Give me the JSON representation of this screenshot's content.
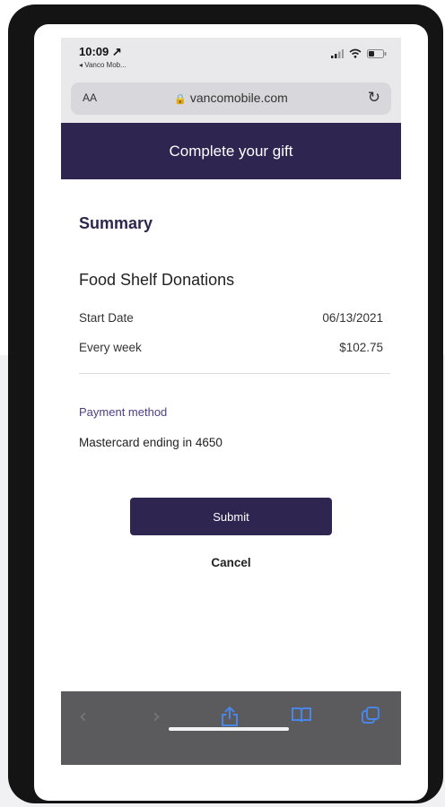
{
  "status_bar": {
    "time": "10:09 ↗",
    "back_app": "◂ Vanco Mob..."
  },
  "browser": {
    "aa_label": "AA",
    "url": "vancomobile.com",
    "lock_icon": "lock-icon",
    "reload_icon": "reload-icon"
  },
  "header": {
    "title": "Complete your gift"
  },
  "summary": {
    "heading": "Summary",
    "fund_name": "Food Shelf Donations",
    "start_date_label": "Start Date",
    "start_date_value": "06/13/2021",
    "frequency_label": "Every week",
    "amount": "$102.75"
  },
  "payment": {
    "label": "Payment method",
    "value": "Mastercard ending in 4650"
  },
  "actions": {
    "submit_label": "Submit",
    "cancel_label": "Cancel"
  },
  "toolbar": {
    "icons": [
      "back-icon",
      "forward-icon",
      "share-icon",
      "bookmarks-icon",
      "tabs-icon"
    ]
  },
  "colors": {
    "brand": "#2e2550",
    "accent_text": "#4d3f83",
    "toolbar_bg": "#5b5b5e",
    "toolbar_icon": "#4a86e8"
  }
}
